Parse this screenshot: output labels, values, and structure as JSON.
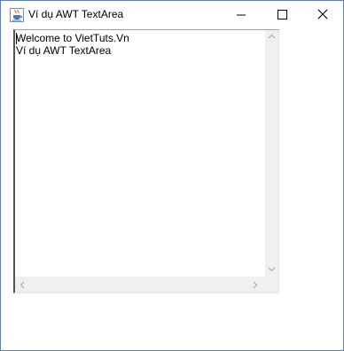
{
  "window": {
    "title": "Ví dụ AWT TextArea",
    "icon": "java-cup-icon"
  },
  "controls": {
    "minimize": "minimize-icon",
    "maximize": "maximize-icon",
    "close": "close-icon"
  },
  "textarea": {
    "lines": [
      "Welcome to VietTuts.Vn",
      "Ví dụ AWT TextArea"
    ]
  },
  "colors": {
    "window_border": "#5a7fb5",
    "scrollbar_track": "#f0f0f0",
    "arrow": "#a3a3a3"
  }
}
